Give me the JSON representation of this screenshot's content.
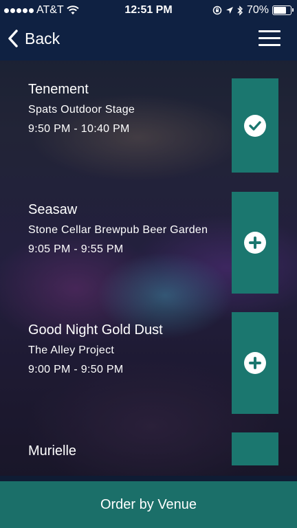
{
  "status_bar": {
    "carrier": "AT&T",
    "time": "12:51 PM",
    "battery_percent": "70%",
    "battery_level": 0.7,
    "icons": [
      "signal-dots-icon",
      "wifi-icon",
      "orientation-lock-icon",
      "location-arrow-icon",
      "bluetooth-icon",
      "battery-icon"
    ]
  },
  "nav": {
    "back_label": "Back",
    "menu_icon": "hamburger-menu-icon"
  },
  "schedule": [
    {
      "artist": "Tenement",
      "venue": "Spats Outdoor Stage",
      "time": "9:50 PM - 10:40 PM",
      "action": "added",
      "icon": "check-circle-icon"
    },
    {
      "artist": "Seasaw",
      "venue": "Stone Cellar Brewpub Beer Garden",
      "time": "9:05 PM - 9:55 PM",
      "action": "add",
      "icon": "plus-circle-icon"
    },
    {
      "artist": "Good Night Gold Dust",
      "venue": "The Alley Project",
      "time": "9:00 PM - 9:50 PM",
      "action": "add",
      "icon": "plus-circle-icon"
    },
    {
      "artist": "Murielle",
      "venue": "",
      "time": "",
      "action": "add",
      "icon": "plus-circle-icon"
    }
  ],
  "footer": {
    "order_label": "Order by Venue"
  },
  "colors": {
    "nav_background": "#0f2142",
    "action_teal": "#1b776f",
    "footer_teal": "#1b6f69"
  }
}
